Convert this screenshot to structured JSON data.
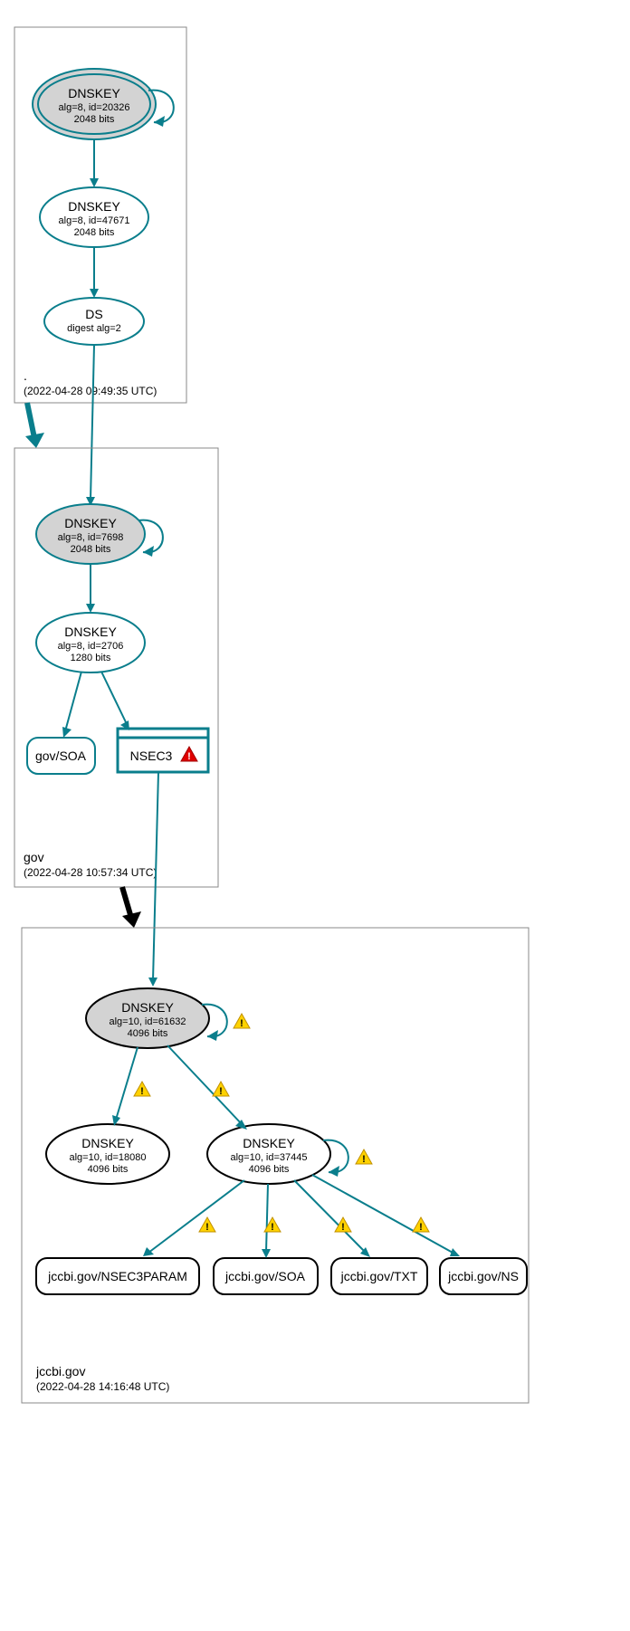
{
  "zones": {
    "root": {
      "name": ".",
      "timestamp": "(2022-04-28 09:49:35 UTC)",
      "ksk": {
        "title": "DNSKEY",
        "alg": "alg=8, id=20326",
        "bits": "2048 bits"
      },
      "zsk": {
        "title": "DNSKEY",
        "alg": "alg=8, id=47671",
        "bits": "2048 bits"
      },
      "ds": {
        "title": "DS",
        "alg": "digest alg=2"
      }
    },
    "gov": {
      "name": "gov",
      "timestamp": "(2022-04-28 10:57:34 UTC)",
      "ksk": {
        "title": "DNSKEY",
        "alg": "alg=8, id=7698",
        "bits": "2048 bits"
      },
      "zsk": {
        "title": "DNSKEY",
        "alg": "alg=8, id=2706",
        "bits": "1280 bits"
      },
      "soa": "gov/SOA",
      "nsec3": "NSEC3"
    },
    "jccbi": {
      "name": "jccbi.gov",
      "timestamp": "(2022-04-28 14:16:48 UTC)",
      "ksk": {
        "title": "DNSKEY",
        "alg": "alg=10, id=61632",
        "bits": "4096 bits"
      },
      "zsk1": {
        "title": "DNSKEY",
        "alg": "alg=10, id=18080",
        "bits": "4096 bits"
      },
      "zsk2": {
        "title": "DNSKEY",
        "alg": "alg=10, id=37445",
        "bits": "4096 bits"
      },
      "rr": {
        "nsec3param": "jccbi.gov/NSEC3PARAM",
        "soa": "jccbi.gov/SOA",
        "txt": "jccbi.gov/TXT",
        "ns": "jccbi.gov/NS"
      }
    }
  }
}
